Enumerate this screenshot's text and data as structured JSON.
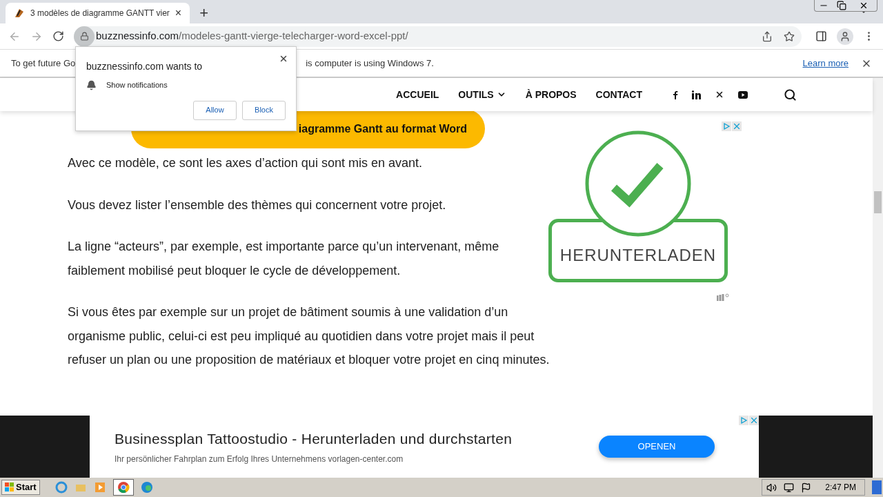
{
  "browser": {
    "tab": {
      "title": "3 modèles de diagramme GANTT vier",
      "close": "×"
    },
    "new_tab": "+",
    "url": {
      "domain": "buzznessinfo.com",
      "path": "/modeles-gantt-vierge-telecharger-word-excel-ppt/"
    }
  },
  "info_bar": {
    "text_before": "To get future Go",
    "text_after": "is computer is using Windows 7.",
    "link": "Learn more"
  },
  "permission_popup": {
    "title": "buzznessinfo.com wants to",
    "item": "Show notifications",
    "buttons": [
      "Allow",
      "Block"
    ]
  },
  "site_nav": {
    "items": [
      {
        "label": "ACCUEIL",
        "has_menu": false
      },
      {
        "label": "OUTILS",
        "has_menu": true
      },
      {
        "label": "À PROPOS",
        "has_menu": false
      },
      {
        "label": "CONTACT",
        "has_menu": false
      }
    ]
  },
  "article": {
    "cta": "iagramme Gantt au format Word",
    "paragraphs": [
      "Avec ce modèle, ce sont les axes d’action qui sont mis en avant.",
      "Vous devez lister l’ensemble des thèmes qui concernent votre projet.",
      "La ligne “acteurs”, par exemple, est importante parce qu’un intervenant, même faiblement mobilisé peut bloquer le cycle de développement.",
      "Si vous êtes par exemple sur un projet de bâtiment soumis à une validation d’un organisme public, celui-ci est peu impliqué au quotidien dans votre projet mais il peut refuser un plan ou une proposition de matériaux et bloquer votre projet en cinq minutes."
    ]
  },
  "side_ad": {
    "label": "HERUNTERLADEN"
  },
  "bottom_ad": {
    "title": "Businessplan Tattoostudio - Herunterladen und durchstarten",
    "subtitle": "Ihr persönlicher Fahrplan zum Erfolg Ihres Unternehmens vorlagen-center.com",
    "button": "OPENEN"
  },
  "taskbar": {
    "start": "Start",
    "clock": "2:47 PM"
  }
}
